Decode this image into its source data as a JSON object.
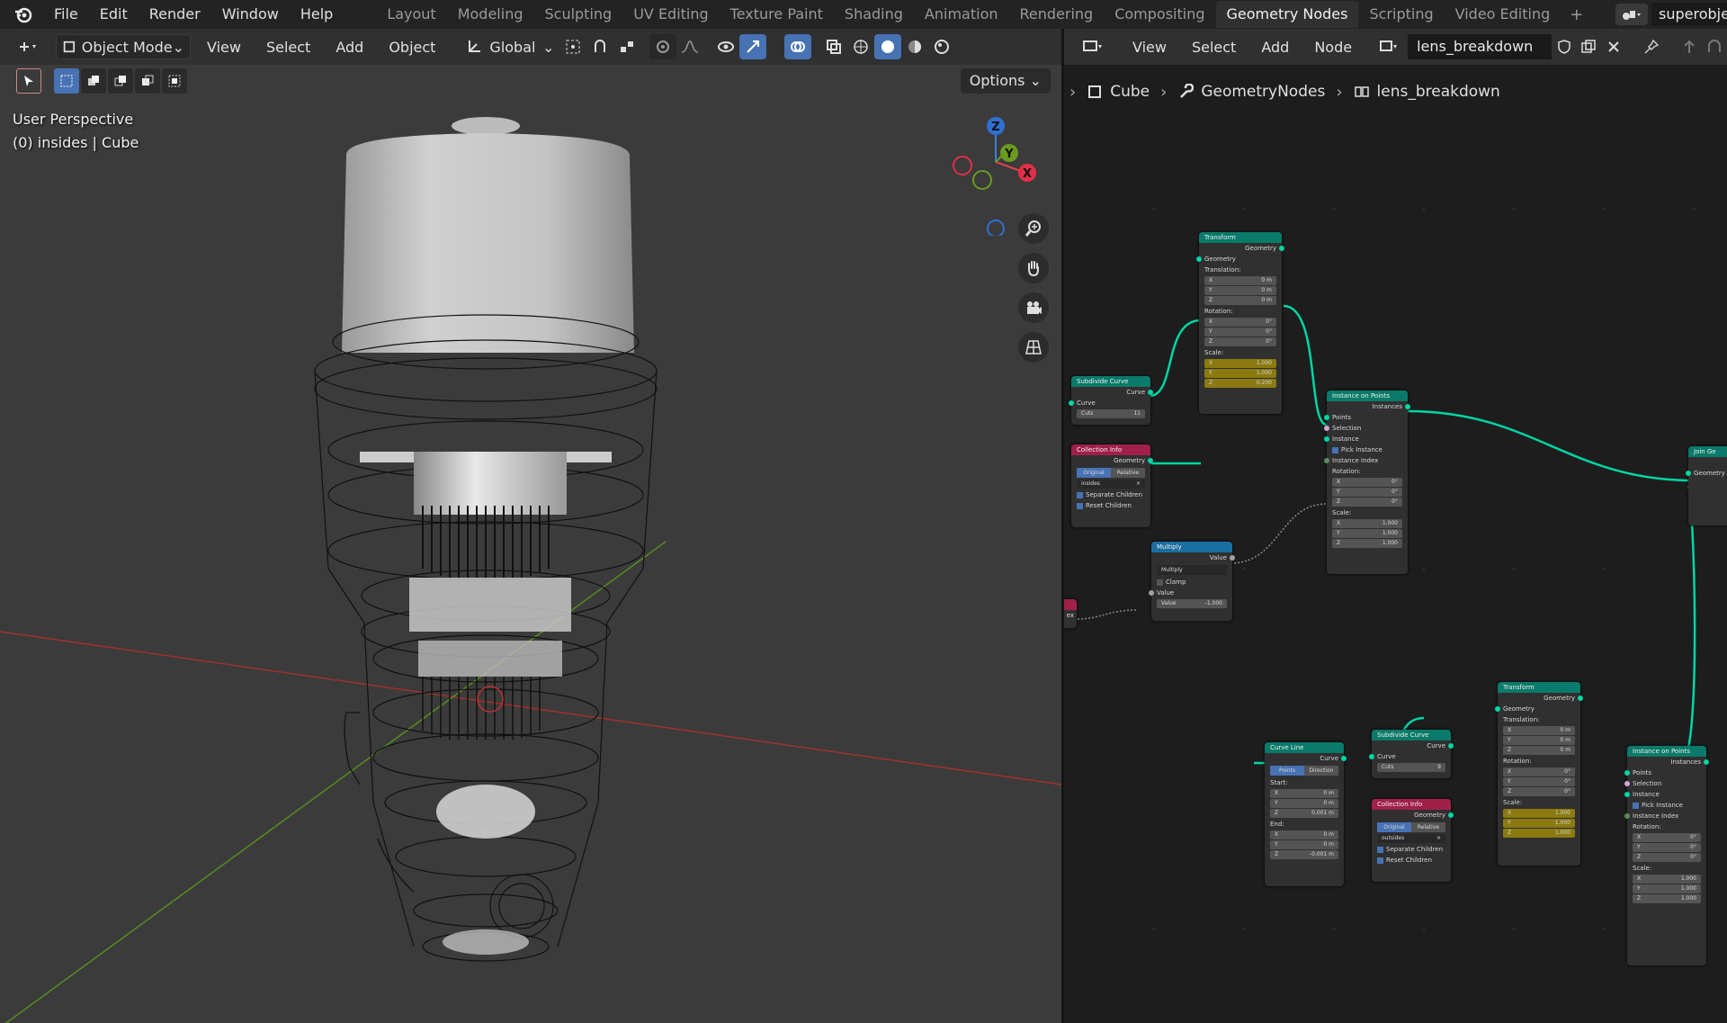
{
  "topbar": {
    "menus": [
      "File",
      "Edit",
      "Render",
      "Window",
      "Help"
    ],
    "workspaces": [
      "Layout",
      "Modeling",
      "Sculpting",
      "UV Editing",
      "Texture Paint",
      "Shading",
      "Animation",
      "Rendering",
      "Compositing",
      "Geometry Nodes",
      "Scripting",
      "Video Editing"
    ],
    "active_workspace": "Geometry Nodes",
    "scene_name": "superobje"
  },
  "viewport": {
    "mode": "Object Mode",
    "menus": [
      "View",
      "Select",
      "Add",
      "Object"
    ],
    "orientation": "Global",
    "options_label": "Options",
    "view_name": "User Perspective",
    "context": "(0) insides | Cube",
    "gizmo": {
      "x": "X",
      "y": "Y",
      "z": "Z"
    }
  },
  "node_editor": {
    "menus": [
      "View",
      "Select",
      "Add",
      "Node"
    ],
    "tree_name": "lens_breakdown",
    "breadcrumb": [
      "Cube",
      "GeometryNodes",
      "lens_breakdown"
    ],
    "nodes": {
      "transform1": {
        "title": "Transform",
        "out": "Geometry",
        "in": "Geometry",
        "translation_label": "Translation:",
        "translation": [
          [
            "X",
            "0 m"
          ],
          [
            "Y",
            "0 m"
          ],
          [
            "Z",
            "0 m"
          ]
        ],
        "rotation_label": "Rotation:",
        "rotation": [
          [
            "X",
            "0°"
          ],
          [
            "Y",
            "0°"
          ],
          [
            "Z",
            "0°"
          ]
        ],
        "scale_label": "Scale:",
        "scale": [
          [
            "X",
            "1.000"
          ],
          [
            "Y",
            "1.000"
          ],
          [
            "Z",
            "0.200"
          ]
        ]
      },
      "subdivide1": {
        "title": "Subdivide Curve",
        "out": "Curve",
        "in": "Curve",
        "cuts_label": "Cuts",
        "cuts": "11"
      },
      "collection1": {
        "title": "Collection Info",
        "out": "Geometry",
        "seg": [
          "Original",
          "Relative"
        ],
        "collection": "insides",
        "sep_children": "Separate Children",
        "reset_children": "Reset Children"
      },
      "instance1": {
        "title": "Instance on Points",
        "out": "Instances",
        "points": "Points",
        "selection": "Selection",
        "instance": "Instance",
        "pick": "Pick Instance",
        "index": "Instance Index",
        "rotation_label": "Rotation:",
        "rotation": [
          [
            "X",
            "0°"
          ],
          [
            "Y",
            "0°"
          ],
          [
            "Z",
            "0°"
          ]
        ],
        "scale_label": "Scale:",
        "scale": [
          [
            "X",
            "1.000"
          ],
          [
            "Y",
            "1.000"
          ],
          [
            "Z",
            "1.000"
          ]
        ]
      },
      "multiply": {
        "title": "Multiply",
        "out": "Value",
        "op": "Multiply",
        "clamp": "Clamp",
        "in": "Value",
        "value_label": "Value",
        "value": "-1.000"
      },
      "join": {
        "title": "Join Ge",
        "in": "Geometry"
      },
      "curve_line": {
        "title": "Curve Line",
        "out": "Curve",
        "seg": [
          "Points",
          "Direction"
        ],
        "start_label": "Start:",
        "start": [
          [
            "X",
            "0 m"
          ],
          [
            "Y",
            "0 m"
          ],
          [
            "Z",
            "0.001 m"
          ]
        ],
        "end_label": "End:",
        "end": [
          [
            "X",
            "0 m"
          ],
          [
            "Y",
            "0 m"
          ],
          [
            "Z",
            "-0.001 m"
          ]
        ]
      },
      "subdivide2": {
        "title": "Subdivide Curve",
        "out": "Curve",
        "in": "Curve",
        "cuts_label": "Cuts",
        "cuts": "9"
      },
      "collection2": {
        "title": "Collection Info",
        "out": "Geometry",
        "seg": [
          "Original",
          "Relative"
        ],
        "collection": "outsides",
        "sep_children": "Separate Children",
        "reset_children": "Reset Children"
      },
      "transform2": {
        "title": "Transform",
        "out": "Geometry",
        "in": "Geometry",
        "translation_label": "Translation:",
        "translation": [
          [
            "X",
            "0 m"
          ],
          [
            "Y",
            "0 m"
          ],
          [
            "Z",
            "0 m"
          ]
        ],
        "rotation_label": "Rotation:",
        "rotation": [
          [
            "X",
            "0°"
          ],
          [
            "Y",
            "0°"
          ],
          [
            "Z",
            "0°"
          ]
        ],
        "scale_label": "Scale:",
        "scale": [
          [
            "X",
            "1.000"
          ],
          [
            "Y",
            "1.000"
          ],
          [
            "Z",
            "1.000"
          ]
        ]
      },
      "instance2": {
        "title": "Instance on Points",
        "out": "Instances",
        "points": "Points",
        "selection": "Selection",
        "instance": "Instance",
        "pick": "Pick Instance",
        "index": "Instance Index",
        "rotation_label": "Rotation:",
        "rotation": [
          [
            "X",
            "0°"
          ],
          [
            "Y",
            "0°"
          ],
          [
            "Z",
            "0°"
          ]
        ],
        "scale_label": "Scale:",
        "scale": [
          [
            "X",
            "1.000"
          ],
          [
            "Y",
            "1.000"
          ],
          [
            "Z",
            "1.000"
          ]
        ]
      },
      "index_stub": {
        "label": "ex"
      }
    }
  },
  "colors": {
    "accent": "#4772b3",
    "geometry_link": "#00d6a3",
    "geo_header": "#0a7a6a",
    "input_header": "#a0204a",
    "util_header": "#1a6ea0"
  }
}
